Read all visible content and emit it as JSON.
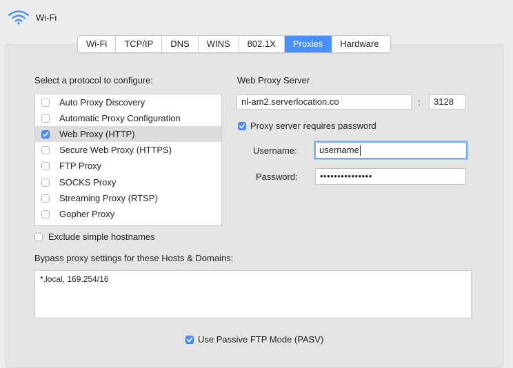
{
  "window": {
    "title": "Wi-Fi"
  },
  "tabs": [
    {
      "label": "Wi-Fi"
    },
    {
      "label": "TCP/IP"
    },
    {
      "label": "DNS"
    },
    {
      "label": "WINS"
    },
    {
      "label": "802.1X"
    },
    {
      "label": "Proxies",
      "active": true
    },
    {
      "label": "Hardware"
    }
  ],
  "protocols": {
    "heading": "Select a protocol to configure:",
    "items": [
      {
        "label": "Auto Proxy Discovery",
        "checked": false
      },
      {
        "label": "Automatic Proxy Configuration",
        "checked": false
      },
      {
        "label": "Web Proxy (HTTP)",
        "checked": true,
        "selected": true
      },
      {
        "label": "Secure Web Proxy (HTTPS)",
        "checked": false
      },
      {
        "label": "FTP Proxy",
        "checked": false
      },
      {
        "label": "SOCKS Proxy",
        "checked": false
      },
      {
        "label": "Streaming Proxy (RTSP)",
        "checked": false
      },
      {
        "label": "Gopher Proxy",
        "checked": false
      }
    ]
  },
  "proxy": {
    "heading": "Web Proxy Server",
    "server": "nl-am2.serverlocation.co",
    "port_separator": ":",
    "port": "3128",
    "requires_password_label": "Proxy server requires password",
    "requires_password": true,
    "username_label": "Username:",
    "username": "username",
    "password_label": "Password:",
    "password_masked": "•••••••••••••••"
  },
  "exclude": {
    "label": "Exclude simple hostnames",
    "checked": false
  },
  "bypass": {
    "label": "Bypass proxy settings for these Hosts & Domains:",
    "value": "*.local, 169.254/16"
  },
  "pasv": {
    "label": "Use Passive FTP Mode (PASV)",
    "checked": true
  },
  "colors": {
    "accent": "#4a8ff7",
    "panel": "#e4e4e4",
    "selected_row": "#dcdcdc"
  }
}
